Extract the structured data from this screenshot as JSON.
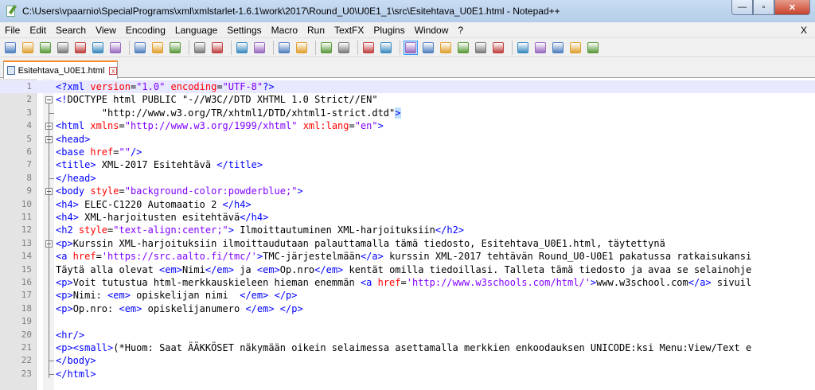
{
  "window": {
    "title": "C:\\Users\\vpaarnio\\SpecialPrograms\\xml\\xmlstarlet-1.6.1\\work\\2017\\Round_U0\\U0E1_1\\src\\Esitehtava_U0E1.html - Notepad++",
    "min_glyph": "—",
    "max_glyph": "▫",
    "close_glyph": "✕"
  },
  "menu": {
    "items": [
      "File",
      "Edit",
      "Search",
      "View",
      "Encoding",
      "Language",
      "Settings",
      "Macro",
      "Run",
      "TextFX",
      "Plugins",
      "Window",
      "?"
    ],
    "close_label": "X"
  },
  "toolbar": {
    "icons": [
      "new-file-icon",
      "open-file-icon",
      "save-icon",
      "save-all-icon",
      "close-icon",
      "close-all-icon",
      "print-icon",
      "sep",
      "cut-icon",
      "copy-icon",
      "paste-icon",
      "sep",
      "undo-icon",
      "redo-icon",
      "sep",
      "find-icon",
      "replace-icon",
      "sep",
      "zoom-in-icon",
      "zoom-out-icon",
      "sep",
      "sync-vertical-icon",
      "sync-horizontal-icon",
      "sep",
      "word-wrap-icon",
      "show-all-chars-icon",
      "sep",
      "indent-guide-icon",
      "user-define-icon",
      "doc-map-icon",
      "function-list-icon",
      "folder-workspace-icon",
      "monitor-icon",
      "sep",
      "record-macro-icon",
      "stop-macro-icon",
      "play-macro-icon",
      "run-macro-multiple-icon",
      "save-macro-icon"
    ]
  },
  "tab": {
    "label": "Esitehtava_U0E1.html",
    "close_glyph": "x"
  },
  "editor": {
    "current_line": 1,
    "lines": [
      {
        "n": "1"
      },
      {
        "n": "2"
      },
      {
        "n": "3"
      },
      {
        "n": "4"
      },
      {
        "n": "5"
      },
      {
        "n": "6"
      },
      {
        "n": "7"
      },
      {
        "n": "8"
      },
      {
        "n": "9"
      },
      {
        "n": "10"
      },
      {
        "n": "11"
      },
      {
        "n": "12"
      },
      {
        "n": "13"
      },
      {
        "n": "14"
      },
      {
        "n": "15"
      },
      {
        "n": "16"
      },
      {
        "n": "17"
      },
      {
        "n": "18"
      },
      {
        "n": "19"
      },
      {
        "n": "20"
      },
      {
        "n": "21"
      },
      {
        "n": "22"
      },
      {
        "n": "23"
      }
    ],
    "code": {
      "l1": [
        "<?",
        "xml",
        " version",
        "=",
        "\"1.0\"",
        " encoding",
        "=",
        "\"UTF-8\"",
        "?>"
      ],
      "l2": [
        "<!",
        "DOCTYPE html PUBLIC \"-//W3C//DTD XHTML 1.0 Strict//EN\""
      ],
      "l3": [
        "        \"http://www.w3.org/TR/xhtml1/DTD/xhtml1-strict.dtd\"",
        ">"
      ],
      "l4": [
        "<html",
        " xmlns",
        "=",
        "\"http://www.w3.org/1999/xhtml\"",
        " xml:lang",
        "=",
        "\"en\"",
        ">"
      ],
      "l5": [
        "<head>"
      ],
      "l6": [
        "<base",
        " href",
        "=",
        "\"\"",
        "/>"
      ],
      "l7": [
        "<title>",
        " XML-2017 Esitehtävä ",
        "</title>"
      ],
      "l8": [
        "</head>"
      ],
      "l9": [
        "<body",
        " style",
        "=",
        "\"background-color:powderblue;\"",
        ">"
      ],
      "l10": [
        "<h4>",
        " ELEC-C1220 Automaatio 2 ",
        "</h4>"
      ],
      "l11": [
        "<h4>",
        " XML-harjoitusten esitehtävä",
        "</h4>"
      ],
      "l12": [
        "<h2",
        " style",
        "=",
        "\"text-align:center;\"",
        ">",
        " Ilmoittautuminen XML-harjoituksiin",
        "</h2>"
      ],
      "l13": [
        "<p>",
        "Kurssin XML-harjoituksiin ilmoittaudutaan palauttamalla tämä tiedosto, Esitehtava_U0E1.html, täytettynä"
      ],
      "l14": [
        "<a",
        " href",
        "=",
        "'https://src.aalto.fi/tmc/'",
        ">",
        "TMC-järjestelmään",
        "</a>",
        " kurssin XML-2017 tehtävän Round_U0-U0E1 pakatussa ratkaisukansi"
      ],
      "l15": [
        "Täytä alla olevat ",
        "<em>",
        "Nimi",
        "</em>",
        " ja ",
        "<em>",
        "Op.nro",
        "</em>",
        " kentät omilla tiedoillasi. Talleta tämä tiedosto ja avaa se selainohje"
      ],
      "l16": [
        "<p>",
        "Voit tutustua html-merkkauskieleen hieman enemmän ",
        "<a",
        " href",
        "=",
        "'http://www.w3schools.com/html/'",
        ">",
        "www.w3school.com",
        "</a>",
        " sivuil"
      ],
      "l17": [
        "<p>",
        "Nimi: ",
        "<em>",
        " opiskelijan nimi  ",
        "</em>",
        " ",
        "</p>"
      ],
      "l18": [
        "<p>",
        "Op.nro: ",
        "<em>",
        " opiskelijanumero ",
        "</em>",
        " ",
        "</p>"
      ],
      "l19": [
        ""
      ],
      "l20": [
        "<hr/>"
      ],
      "l21": [
        "<p>",
        "<small>",
        "(*Huom: Saat ÄÄKKÖSET näkymään oikein selaimessa asettamalla merkkien enkoodauksen UNICODE:ksi Menu:View/Text e"
      ],
      "l22": [
        "</body>"
      ],
      "l23": [
        "</html>"
      ]
    },
    "styles": {
      "l1": [
        "k",
        "k",
        "a",
        "t",
        "v",
        "a",
        "t",
        "v",
        "k"
      ],
      "l2": [
        "k",
        "dt"
      ],
      "l3": [
        "dt",
        "k hl"
      ],
      "l4": [
        "k",
        "a",
        "t",
        "v",
        "a",
        "t",
        "v",
        "k"
      ],
      "l5": [
        "k"
      ],
      "l6": [
        "k",
        "a",
        "t",
        "v",
        "k"
      ],
      "l7": [
        "k",
        "t",
        "k"
      ],
      "l8": [
        "k"
      ],
      "l9": [
        "k",
        "a",
        "t",
        "v",
        "k"
      ],
      "l10": [
        "k",
        "t",
        "k"
      ],
      "l11": [
        "k",
        "t",
        "k"
      ],
      "l12": [
        "k",
        "a",
        "t",
        "v",
        "k",
        "t",
        "k"
      ],
      "l13": [
        "k",
        "t"
      ],
      "l14": [
        "k",
        "a",
        "t",
        "v",
        "k",
        "t",
        "k",
        "t"
      ],
      "l15": [
        "t",
        "k",
        "t",
        "k",
        "t",
        "k",
        "t",
        "k",
        "t"
      ],
      "l16": [
        "k",
        "t",
        "k",
        "a",
        "t",
        "v",
        "k",
        "t",
        "k",
        "t"
      ],
      "l17": [
        "k",
        "t",
        "k",
        "t",
        "k",
        "t",
        "k"
      ],
      "l18": [
        "k",
        "t",
        "k",
        "t",
        "k",
        "t",
        "k"
      ],
      "l19": [
        "t"
      ],
      "l20": [
        "k"
      ],
      "l21": [
        "k",
        "k",
        "t"
      ],
      "l22": [
        "k"
      ],
      "l23": [
        "k"
      ]
    },
    "folds": {
      "2": "open",
      "4": "open",
      "5": "open",
      "9": "open",
      "13": "open"
    }
  },
  "colors": {
    "tag": "#0000ff",
    "attribute": "#ff0000",
    "value": "#8000ff",
    "current_line": "#e8e8ff",
    "tab_accent": "#fa8a2b"
  }
}
